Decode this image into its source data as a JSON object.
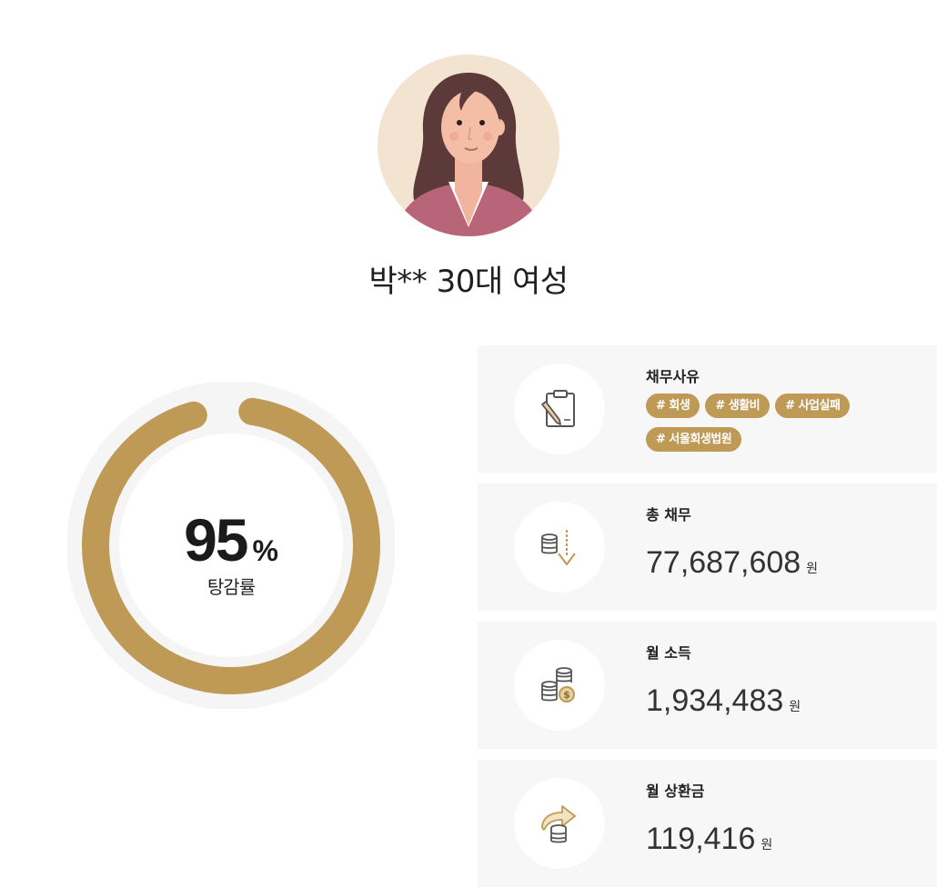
{
  "profile": {
    "name": "박** 30대 여성"
  },
  "gauge": {
    "percent": 95,
    "value_text": "95",
    "unit": "%",
    "label": "탕감률",
    "fill_color": "#bf9a57",
    "track_color": "#f5f5f5"
  },
  "cards": {
    "reason": {
      "title": "채무사유",
      "icon": "clipboard-pencil-icon",
      "tags": [
        "# 회생",
        "# 생활비",
        "# 사업실패",
        "# 서울회생법원"
      ]
    },
    "total_debt": {
      "title": "총 채무",
      "icon": "coins-arrow-down-icon",
      "value": "77,687,608",
      "unit": "원"
    },
    "monthly_income": {
      "title": "월 소득",
      "icon": "coin-stacks-icon",
      "value": "1,934,483",
      "unit": "원"
    },
    "monthly_repayment": {
      "title": "월 상환금",
      "icon": "coins-arrow-right-icon",
      "value": "119,416",
      "unit": "원"
    }
  },
  "colors": {
    "accent": "#bf9a57",
    "card_background": "#f7f7f7",
    "text": "#222222"
  }
}
